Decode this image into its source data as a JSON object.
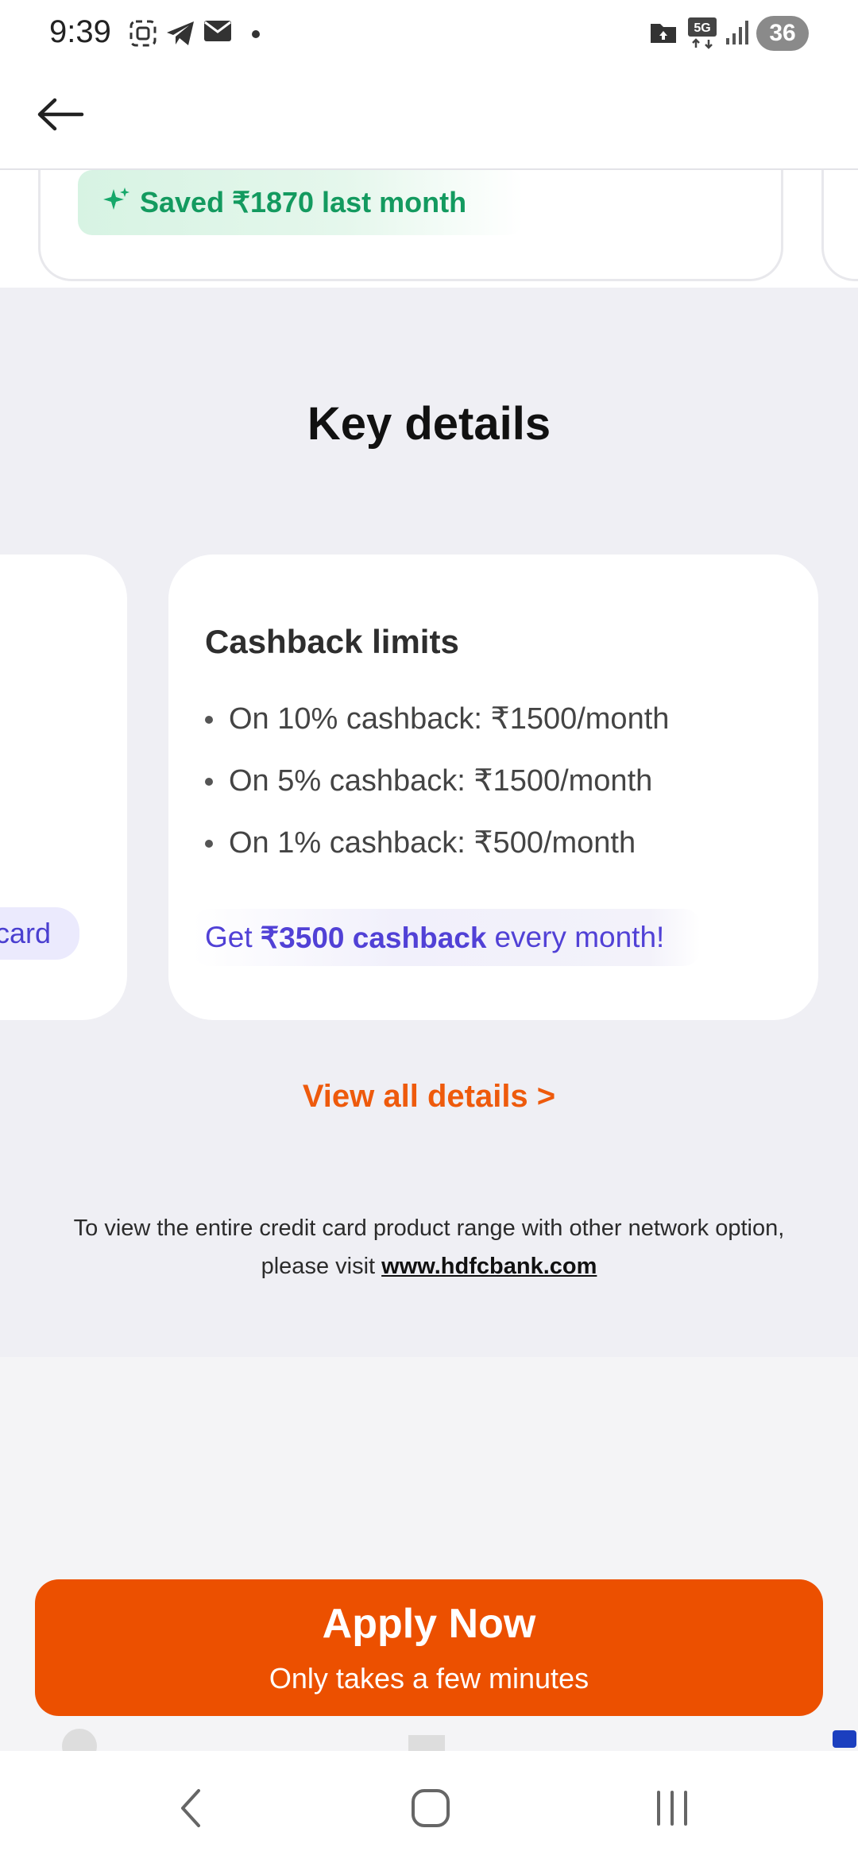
{
  "status_bar": {
    "time": "9:39",
    "network": "5G",
    "battery": "36",
    "icons": [
      "screenshot-icon",
      "telegram-icon",
      "mail-icon",
      "dot-icon",
      "folder-icon",
      "5g-icon",
      "signal-icon",
      "battery-icon"
    ]
  },
  "top_bar": {
    "back_icon": "back-arrow-icon"
  },
  "savings": {
    "text": "Saved ₹1870 last month",
    "accent": "#139a5f"
  },
  "key_details": {
    "title": "Key details",
    "prev_card_tag": "card",
    "card": {
      "title": "Cashback limits",
      "bullets": [
        "On 10% cashback: ₹1500/month",
        "On 5% cashback: ₹1500/month",
        "On 1% cashback: ₹500/month"
      ],
      "promo_prefix": "Get",
      "promo_bold": "₹3500 cashback",
      "promo_suffix": "every month!"
    },
    "view_all": "View all details >",
    "disclaimer_text": "To view the entire credit card product range with other network option, please visit",
    "disclaimer_link": "www.hdfcbank.com"
  },
  "apply_button": {
    "label": "Apply Now",
    "sublabel": "Only takes a few minutes",
    "color": "#ec5000"
  },
  "nav_bar": {
    "icons": [
      "nav-back-icon",
      "nav-home-icon",
      "nav-recents-icon"
    ]
  }
}
